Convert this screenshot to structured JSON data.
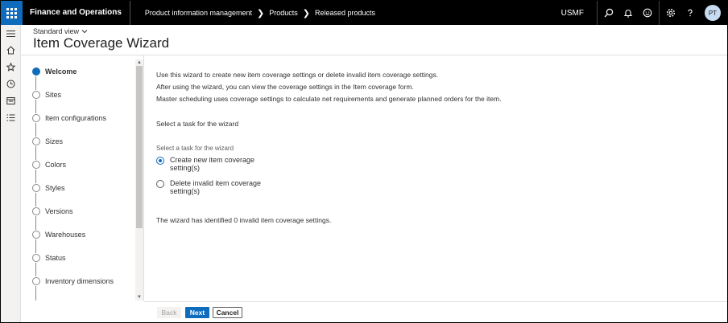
{
  "topbar": {
    "app_title": "Finance and Operations",
    "breadcrumbs": [
      "Product information management",
      "Products",
      "Released products"
    ],
    "company": "USMF",
    "user_initials": "PT",
    "icons": [
      "search-icon",
      "bell-icon",
      "smiley-icon",
      "gear-icon",
      "help-icon"
    ]
  },
  "navpane": {
    "icons": [
      "hamburger-icon",
      "home-icon",
      "star-icon",
      "clock-icon",
      "workspace-icon",
      "list-icon"
    ]
  },
  "header": {
    "view_label": "Standard view",
    "title": "Item Coverage Wizard"
  },
  "steps": [
    {
      "label": "Welcome",
      "active": true
    },
    {
      "label": "Sites",
      "active": false
    },
    {
      "label": "Item configurations",
      "active": false
    },
    {
      "label": "Sizes",
      "active": false
    },
    {
      "label": "Colors",
      "active": false
    },
    {
      "label": "Styles",
      "active": false
    },
    {
      "label": "Versions",
      "active": false
    },
    {
      "label": "Warehouses",
      "active": false
    },
    {
      "label": "Status",
      "active": false
    },
    {
      "label": "Inventory dimensions",
      "active": false
    }
  ],
  "content": {
    "intro_1": "Use this wizard to create new item coverage settings or delete invalid item coverage settings.",
    "intro_2": "After using the wizard, you can view the coverage settings in the Item coverage form.",
    "intro_3": "Master scheduling uses coverage settings to calculate net requirements and generate planned orders for the item.",
    "task_heading": "Select a task for the wizard",
    "group_label": "Select a task for the wizard",
    "option_create": "Create new item coverage setting(s)",
    "option_delete": "Delete invalid item coverage setting(s)",
    "identified": "The wizard has identified 0 invalid item coverage settings."
  },
  "footer": {
    "back": "Back",
    "next": "Next",
    "cancel": "Cancel"
  },
  "colors": {
    "accent": "#0f6cbd",
    "topbar": "#000000"
  }
}
